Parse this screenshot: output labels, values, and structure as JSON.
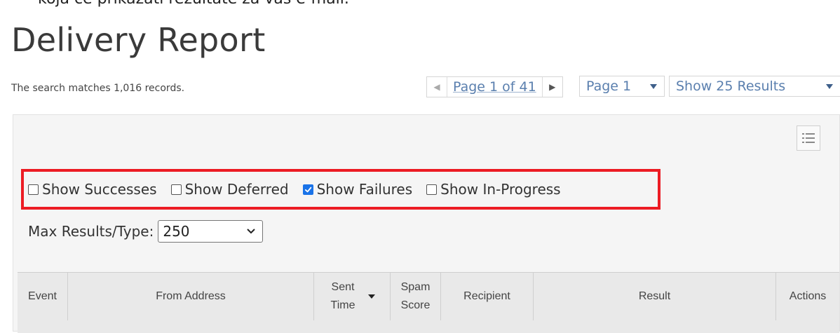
{
  "caption_fragment": "koja će prikazati rezultate za vaš e-mail.",
  "page_title": "Delivery Report",
  "records_text": "The search matches 1,016 records.",
  "pager": {
    "label": "Page 1 of 41",
    "page_select": "Page 1",
    "results_select": "Show 25 Results"
  },
  "filters": [
    {
      "label": "Show Successes",
      "checked": false
    },
    {
      "label": "Show Deferred",
      "checked": false
    },
    {
      "label": "Show Failures",
      "checked": true
    },
    {
      "label": "Show In-Progress",
      "checked": false
    }
  ],
  "max_results": {
    "label": "Max Results/Type:",
    "value": "250"
  },
  "table": {
    "columns": [
      "Event",
      "From Address",
      "Sent Time",
      "Spam Score",
      "Recipient",
      "Result",
      "Actions"
    ]
  },
  "colors": {
    "highlight": "#ec1c24",
    "link": "#5a7fae",
    "checkbox_checked": "#1a73e8"
  }
}
